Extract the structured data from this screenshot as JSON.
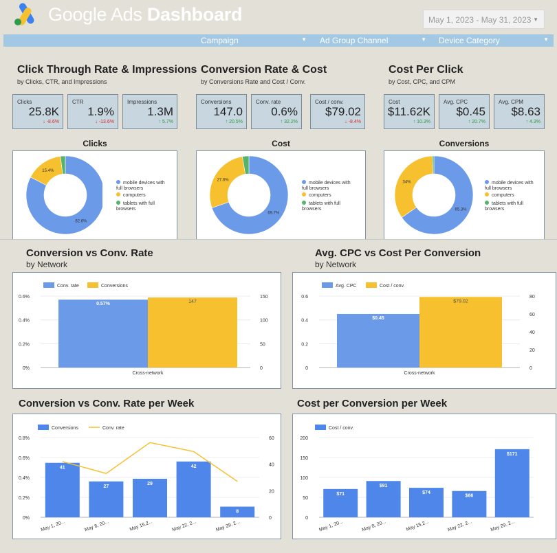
{
  "header": {
    "title_light": "Google Ads",
    "title_bold": "Dashboard",
    "date_range": "May 1, 2023 - May 31, 2023"
  },
  "filters": [
    "Campaign",
    "Ad Group Channel",
    "Device Category"
  ],
  "sections": {
    "ctr": {
      "title": "Click Through Rate & Impressions",
      "subtitle": "by Clicks, CTR, and Impressions",
      "kpis": [
        {
          "label": "Clicks",
          "value": "25.8K",
          "delta": "↓ -8.6%",
          "dir": "down"
        },
        {
          "label": "CTR",
          "value": "1.9%",
          "delta": "↓ -13.6%",
          "dir": "down"
        },
        {
          "label": "Impressions",
          "value": "1.3M",
          "delta": "↑ 5.7%",
          "dir": "up"
        }
      ],
      "chart_title": "Clicks"
    },
    "conv": {
      "title": "Conversion Rate & Cost",
      "subtitle": "by Conversions Rate and Cost / Conv.",
      "kpis": [
        {
          "label": "Conversions",
          "value": "147.0",
          "delta": "↑ 20.5%",
          "dir": "up"
        },
        {
          "label": "Conv. rate",
          "value": "0.6%",
          "delta": "↑ 32.2%",
          "dir": "up"
        },
        {
          "label": "Cost / conv.",
          "value": "$79.02",
          "delta": "↓ -8.4%",
          "dir": "down"
        }
      ],
      "chart_title": "Cost"
    },
    "cpc": {
      "title": "Cost Per Click",
      "subtitle": "by Cost, CPC, and CPM",
      "kpis": [
        {
          "label": "Cost",
          "value": "$11.62K",
          "delta": "↑ 10.3%",
          "dir": "up"
        },
        {
          "label": "Avg. CPC",
          "value": "$0.45",
          "delta": "↑ 20.7%",
          "dir": "up"
        },
        {
          "label": "Avg. CPM",
          "value": "$8.63",
          "delta": "↑ 4.3%",
          "dir": "up"
        }
      ],
      "chart_title": "Conversions"
    },
    "bar1": {
      "title": "Conversion vs Conv. Rate",
      "subtitle": "by Network"
    },
    "bar2": {
      "title": "Avg. CPC vs Cost Per Conversion",
      "subtitle": "by Network"
    },
    "week1": {
      "title": "Conversion vs Conv. Rate per Week"
    },
    "week2": {
      "title": "Cost per Conversion per Week"
    }
  },
  "colors": {
    "blue": "#4f86e9",
    "blue_light": "#6b9ae9",
    "yellow": "#f6c02e",
    "green": "#57b26c",
    "kpi_bg": "#c8d6e0",
    "filter_bar": "#a2c8e4"
  },
  "chart_data": [
    {
      "type": "pie",
      "title": "Clicks",
      "labels": [
        "mobile devices with full browsers",
        "computers",
        "tablets with full browsers"
      ],
      "values": [
        82.6,
        15.4,
        2.0
      ],
      "value_labels": [
        "82.6%",
        "15.4%",
        ""
      ]
    },
    {
      "type": "pie",
      "title": "Cost",
      "labels": [
        "mobile devices with full browsers",
        "computers",
        "tablets with full browsers"
      ],
      "values": [
        69.7,
        27.6,
        2.7
      ],
      "value_labels": [
        "69.7%",
        "27.6%",
        ""
      ]
    },
    {
      "type": "pie",
      "title": "Conversions",
      "labels": [
        "mobile devices with full browsers",
        "computers",
        "tablets with full browsers"
      ],
      "values": [
        65.3,
        34.0,
        0.7
      ],
      "value_labels": [
        "65.3%",
        "34%",
        ""
      ]
    },
    {
      "type": "bar",
      "title": "Conversion vs Conv. Rate",
      "categories": [
        "Cross-network"
      ],
      "series": [
        {
          "name": "Conv. rate",
          "values": [
            0.57
          ],
          "label": "0.57%",
          "axis": "left"
        },
        {
          "name": "Conversions",
          "values": [
            147
          ],
          "label": "147",
          "axis": "right"
        }
      ],
      "y_left": {
        "ticks": [
          "0%",
          "0.2%",
          "0.4%",
          "0.6%"
        ],
        "range": [
          0,
          0.6
        ]
      },
      "y_right": {
        "ticks": [
          "0",
          "50",
          "100",
          "150"
        ],
        "range": [
          0,
          150
        ]
      }
    },
    {
      "type": "bar",
      "title": "Avg. CPC vs Cost Per Conversion",
      "categories": [
        "Cross-network"
      ],
      "series": [
        {
          "name": "Avg. CPC",
          "values": [
            0.45
          ],
          "label": "$0.45",
          "axis": "left"
        },
        {
          "name": "Cost / conv.",
          "values": [
            79.02
          ],
          "label": "$79.02",
          "axis": "right"
        }
      ],
      "y_left": {
        "ticks": [
          "0",
          "0.2",
          "0.4",
          "0.6"
        ],
        "range": [
          0,
          0.6
        ]
      },
      "y_right": {
        "ticks": [
          "0",
          "20",
          "40",
          "60",
          "80"
        ],
        "range": [
          0,
          80
        ]
      }
    },
    {
      "type": "bar",
      "title": "Conversion vs Conv. Rate per Week",
      "categories": [
        "May 1, 20...",
        "May 8, 20...",
        "May 15,2...",
        "May 22, 2...",
        "May 29, 2..."
      ],
      "series": [
        {
          "name": "Conversions",
          "values": [
            41,
            27,
            29,
            42,
            8
          ],
          "labels": [
            "41",
            "27",
            "29",
            "42",
            "8"
          ],
          "axis": "right",
          "mark": "bar"
        },
        {
          "name": "Conv. rate",
          "values": [
            0.56,
            0.44,
            0.75,
            0.66,
            0.36
          ],
          "axis": "left",
          "mark": "line"
        }
      ],
      "y_left": {
        "ticks": [
          "0%",
          "0.2%",
          "0.4%",
          "0.6%",
          "0.8%"
        ],
        "range": [
          0,
          0.8
        ]
      },
      "y_right": {
        "ticks": [
          "0",
          "20",
          "40",
          "60"
        ],
        "range": [
          0,
          60
        ]
      }
    },
    {
      "type": "bar",
      "title": "Cost per Conversion per Week",
      "categories": [
        "May 1, 20...",
        "May 8, 20...",
        "May 15,2...",
        "May 22, 2...",
        "May 29, 2..."
      ],
      "series": [
        {
          "name": "Cost / conv.",
          "values": [
            71,
            91,
            74,
            66,
            171
          ],
          "labels": [
            "$71",
            "$91",
            "$74",
            "$66",
            "$171"
          ]
        }
      ],
      "y_left": {
        "ticks": [
          "0",
          "50",
          "100",
          "150",
          "200"
        ],
        "range": [
          0,
          200
        ]
      }
    }
  ]
}
